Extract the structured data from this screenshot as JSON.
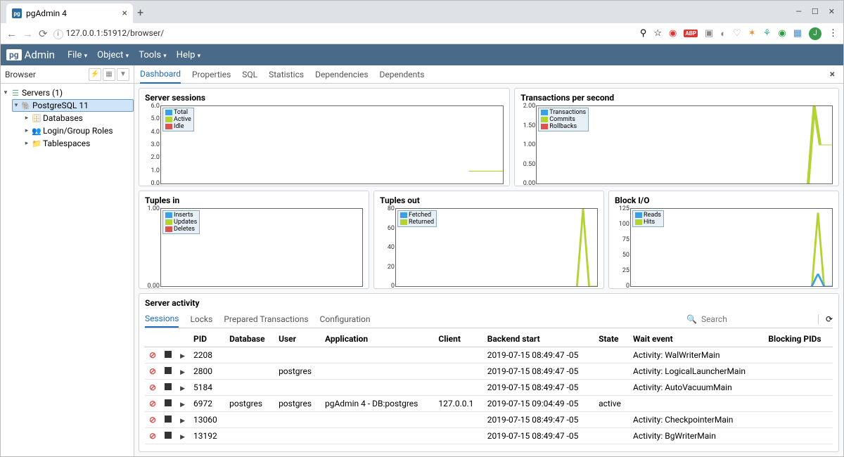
{
  "browser": {
    "tab_title": "pgAdmin 4",
    "url": "127.0.0.1:51912/browser/"
  },
  "pga": {
    "brand": "Admin",
    "menus": [
      "File",
      "Object",
      "Tools",
      "Help"
    ]
  },
  "sidebar": {
    "title": "Browser",
    "root": "Servers (1)",
    "server": "PostgreSQL 11",
    "children": [
      "Databases",
      "Login/Group Roles",
      "Tablespaces"
    ]
  },
  "tabs": [
    "Dashboard",
    "Properties",
    "SQL",
    "Statistics",
    "Dependencies",
    "Dependents"
  ],
  "charts": {
    "sessions": {
      "title": "Server sessions",
      "yticks": [
        "6.0",
        "5.0",
        "4.0",
        "3.0",
        "2.0",
        "1.0",
        "0.0"
      ],
      "legend": [
        [
          "Total",
          "c-blue"
        ],
        [
          "Active",
          "c-green"
        ],
        [
          "Idle",
          "c-red"
        ]
      ]
    },
    "tps": {
      "title": "Transactions per second",
      "yticks": [
        "2.00",
        "1.50",
        "1.00",
        "0.50",
        "0.00"
      ],
      "legend": [
        [
          "Transactions",
          "c-blue"
        ],
        [
          "Commits",
          "c-green"
        ],
        [
          "Rollbacks",
          "c-red"
        ]
      ]
    },
    "tin": {
      "title": "Tuples in",
      "yticks": [
        "1.00",
        "0.00"
      ],
      "legend": [
        [
          "Inserts",
          "c-blue"
        ],
        [
          "Updates",
          "c-green"
        ],
        [
          "Deletes",
          "c-red"
        ]
      ]
    },
    "tout": {
      "title": "Tuples out",
      "yticks": [
        "80",
        "60",
        "40",
        "20",
        "0"
      ],
      "legend": [
        [
          "Fetched",
          "c-blue"
        ],
        [
          "Returned",
          "c-green"
        ]
      ]
    },
    "bio": {
      "title": "Block I/O",
      "yticks": [
        "125",
        "100",
        "75",
        "50",
        "25",
        "0"
      ],
      "legend": [
        [
          "Reads",
          "c-blue"
        ],
        [
          "Hits",
          "c-green"
        ]
      ]
    }
  },
  "activity": {
    "title": "Server activity",
    "tabs": [
      "Sessions",
      "Locks",
      "Prepared Transactions",
      "Configuration"
    ],
    "search_placeholder": "Search",
    "columns": [
      "",
      "",
      "",
      "PID",
      "Database",
      "User",
      "Application",
      "Client",
      "Backend start",
      "State",
      "Wait event",
      "Blocking PIDs"
    ],
    "rows": [
      {
        "pid": "2208",
        "db": "",
        "user": "",
        "app": "",
        "client": "",
        "start": "2019-07-15 08:49:47 -05",
        "state": "",
        "wait": "Activity: WalWriterMain",
        "block": ""
      },
      {
        "pid": "2800",
        "db": "",
        "user": "postgres",
        "app": "",
        "client": "",
        "start": "2019-07-15 08:49:47 -05",
        "state": "",
        "wait": "Activity: LogicalLauncherMain",
        "block": ""
      },
      {
        "pid": "5184",
        "db": "",
        "user": "",
        "app": "",
        "client": "",
        "start": "2019-07-15 08:49:47 -05",
        "state": "",
        "wait": "Activity: AutoVacuumMain",
        "block": ""
      },
      {
        "pid": "6972",
        "db": "postgres",
        "user": "postgres",
        "app": "pgAdmin 4 - DB:postgres",
        "client": "127.0.0.1",
        "start": "2019-07-15 09:04:49 -05",
        "state": "active",
        "wait": "",
        "block": ""
      },
      {
        "pid": "13060",
        "db": "",
        "user": "",
        "app": "",
        "client": "",
        "start": "2019-07-15 08:49:47 -05",
        "state": "",
        "wait": "Activity: CheckpointerMain",
        "block": ""
      },
      {
        "pid": "13192",
        "db": "",
        "user": "",
        "app": "",
        "client": "",
        "start": "2019-07-15 08:49:47 -05",
        "state": "",
        "wait": "Activity: BgWriterMain",
        "block": ""
      }
    ]
  },
  "chart_data": [
    {
      "type": "line",
      "title": "Server sessions",
      "ylim": [
        0,
        6
      ],
      "series": [
        {
          "name": "Total",
          "values": [
            1
          ]
        },
        {
          "name": "Active",
          "values": [
            1
          ]
        },
        {
          "name": "Idle",
          "values": [
            0
          ]
        }
      ]
    },
    {
      "type": "line",
      "title": "Transactions per second",
      "ylim": [
        0,
        2
      ],
      "series": [
        {
          "name": "Transactions",
          "values": [
            0,
            0,
            2,
            1,
            1
          ]
        },
        {
          "name": "Commits",
          "values": [
            0,
            0,
            2,
            1,
            1
          ]
        },
        {
          "name": "Rollbacks",
          "values": [
            0
          ]
        }
      ]
    },
    {
      "type": "line",
      "title": "Tuples in",
      "ylim": [
        0,
        1
      ],
      "series": [
        {
          "name": "Inserts",
          "values": [
            0
          ]
        },
        {
          "name": "Updates",
          "values": [
            0
          ]
        },
        {
          "name": "Deletes",
          "values": [
            0
          ]
        }
      ]
    },
    {
      "type": "line",
      "title": "Tuples out",
      "ylim": [
        0,
        80
      ],
      "series": [
        {
          "name": "Fetched",
          "values": [
            0,
            0,
            80,
            0
          ]
        },
        {
          "name": "Returned",
          "values": [
            0,
            0,
            80,
            0
          ]
        }
      ]
    },
    {
      "type": "line",
      "title": "Block I/O",
      "ylim": [
        0,
        125
      ],
      "series": [
        {
          "name": "Reads",
          "values": [
            0,
            0,
            20,
            0
          ]
        },
        {
          "name": "Hits",
          "values": [
            0,
            0,
            120,
            0
          ]
        }
      ]
    }
  ]
}
